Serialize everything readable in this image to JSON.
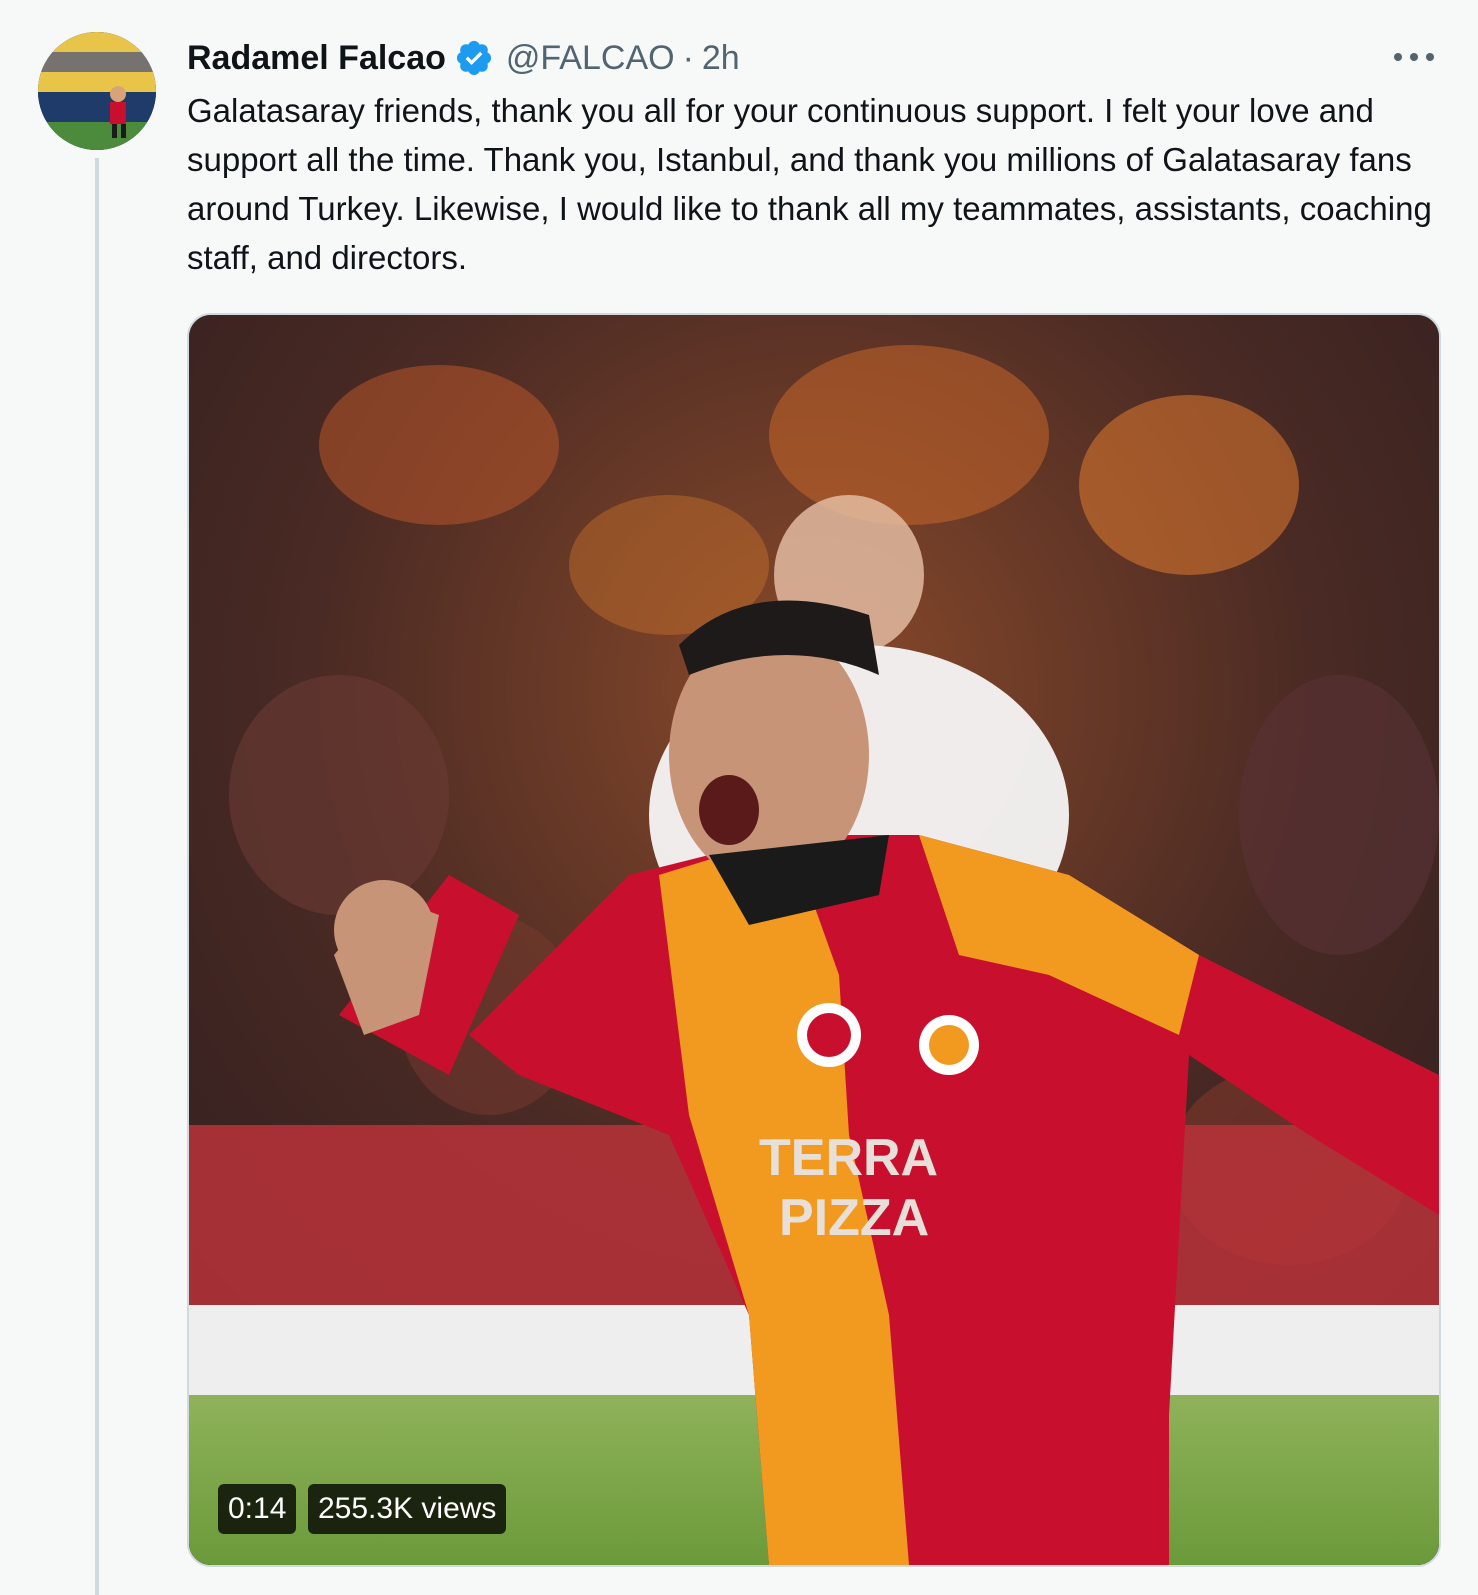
{
  "tweet": {
    "author_name": "Radamel Falcao",
    "handle": "@FALCAO",
    "separator": "·",
    "timestamp": "2h",
    "text": "Galatasaray friends, thank you all for your continuous support.  I felt your love and support all the time. Thank you, Istanbul, and thank you millions of Galatasaray fans around Turkey.  Likewise, I would like to thank all my teammates, assistants, coaching staff, and directors.",
    "verified": true,
    "more_icon": "more-horizontal-icon"
  },
  "media": {
    "type": "video",
    "duration": "0:14",
    "views": "255.3K views",
    "jersey_text_line1": "TERRA",
    "jersey_text_line2": "PIZZA"
  },
  "colors": {
    "verified_blue": "#1d9bf0",
    "secondary_text": "#536471",
    "jersey_red": "#c8102e",
    "jersey_orange": "#f29a1f"
  }
}
